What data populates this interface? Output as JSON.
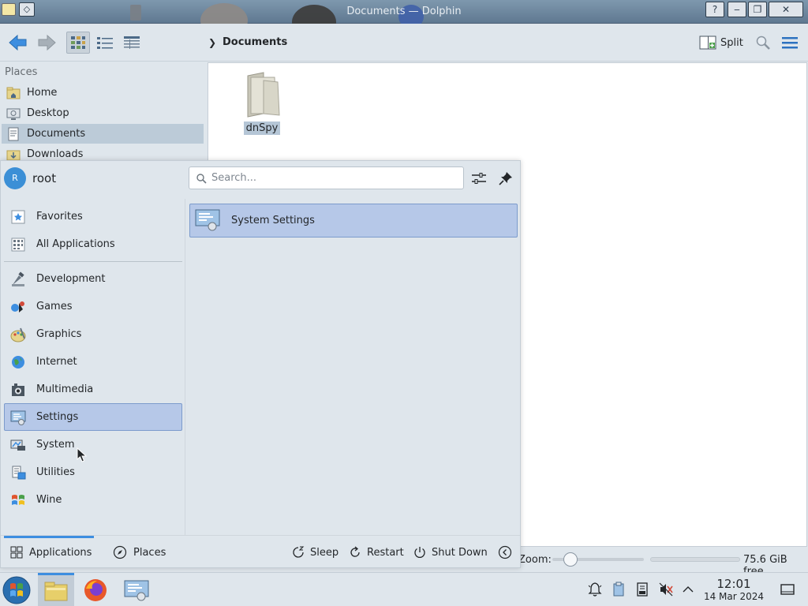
{
  "window": {
    "title": "Documents — Dolphin",
    "help_btn": "?",
    "minimize_btn": "‒",
    "maximize_btn": "❐",
    "close_btn": "✕",
    "pin_glyph": "◇"
  },
  "toolbar": {
    "breadcrumb": "Documents",
    "split_label": "Split"
  },
  "places": {
    "title": "Places",
    "items": [
      {
        "label": "Home",
        "icon": "home-folder-icon"
      },
      {
        "label": "Desktop",
        "icon": "desktop-icon"
      },
      {
        "label": "Documents",
        "icon": "documents-folder-icon",
        "selected": true
      },
      {
        "label": "Downloads",
        "icon": "downloads-folder-icon"
      }
    ]
  },
  "files": [
    {
      "name": "dnSpy",
      "icon": "folder-icon"
    }
  ],
  "statusbar": {
    "zoom_label": "Zoom:",
    "zoom_level": 0.2,
    "free_space": "75.6 GiB free"
  },
  "launcher": {
    "user": {
      "name": "root",
      "initial": "R"
    },
    "search": {
      "placeholder": "Search...",
      "value": ""
    },
    "categories": [
      {
        "label": "Favorites",
        "icon": "favorites-icon"
      },
      {
        "label": "All Applications",
        "icon": "all-applications-icon"
      },
      {
        "label": "Development",
        "icon": "development-icon"
      },
      {
        "label": "Games",
        "icon": "games-icon"
      },
      {
        "label": "Graphics",
        "icon": "graphics-icon"
      },
      {
        "label": "Internet",
        "icon": "internet-icon"
      },
      {
        "label": "Multimedia",
        "icon": "multimedia-icon"
      },
      {
        "label": "Settings",
        "icon": "settings-icon",
        "selected": true
      },
      {
        "label": "System",
        "icon": "system-icon"
      },
      {
        "label": "Utilities",
        "icon": "utilities-icon"
      },
      {
        "label": "Wine",
        "icon": "wine-icon"
      }
    ],
    "results": [
      {
        "label": "System Settings",
        "icon": "system-settings-icon"
      }
    ],
    "footer": {
      "tabs": [
        {
          "label": "Applications",
          "active": true
        },
        {
          "label": "Places",
          "active": false
        }
      ],
      "sleep": "Sleep",
      "restart": "Restart",
      "shutdown": "Shut Down"
    }
  },
  "taskbar": {
    "time": "12:01",
    "date": "14 Mar 2024"
  },
  "colors": {
    "accent": "#3d8ee0",
    "selection": "#b6c8e8",
    "panel_bg": "#dfe6ec"
  }
}
